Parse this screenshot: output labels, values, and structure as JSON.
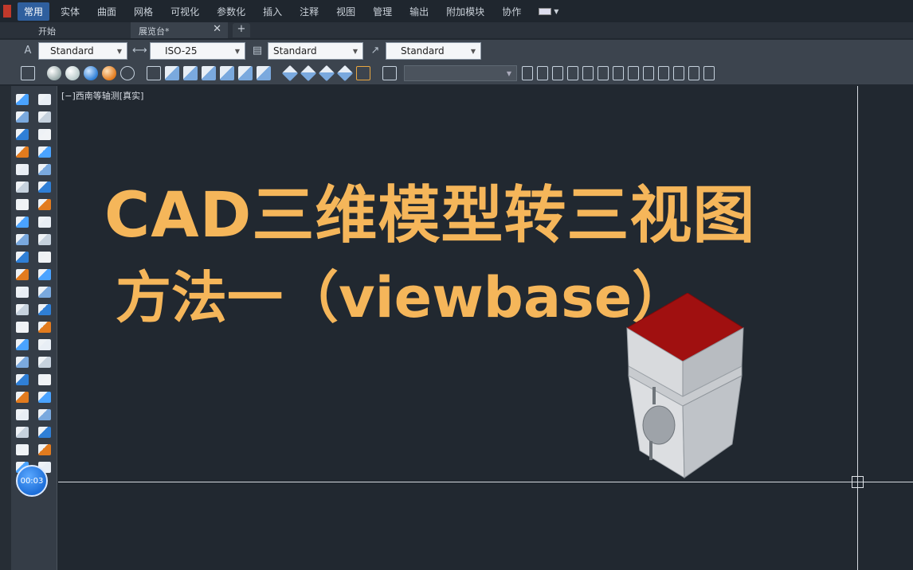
{
  "ribbon": {
    "tabs": [
      "常用",
      "实体",
      "曲面",
      "网格",
      "可视化",
      "参数化",
      "插入",
      "注释",
      "视图",
      "管理",
      "输出",
      "附加模块",
      "协作"
    ],
    "active_tab": "常用"
  },
  "doc_tabs": {
    "start_label": "开始",
    "active_label": "展览台*",
    "close_glyph": "✕",
    "new_glyph": "+"
  },
  "toolbar1": {
    "text_style": "Standard",
    "dim_style": "ISO-25",
    "table_style": "Standard",
    "mleader_style": "Standard"
  },
  "toolbar2": {
    "view_combo_value": ""
  },
  "viewport": {
    "view_label": "[−]西南等轴测[真实]",
    "title_line1": "CAD三维模型转三视图",
    "title_line2": "方法一（viewbase）"
  },
  "badge": {
    "timer": "00:03"
  },
  "colors": {
    "title": "#f5b65a",
    "model_top": "#a01010",
    "model_body": "#cfd2d6",
    "active_tab": "#2f5f9e",
    "canvas": "#212830"
  }
}
